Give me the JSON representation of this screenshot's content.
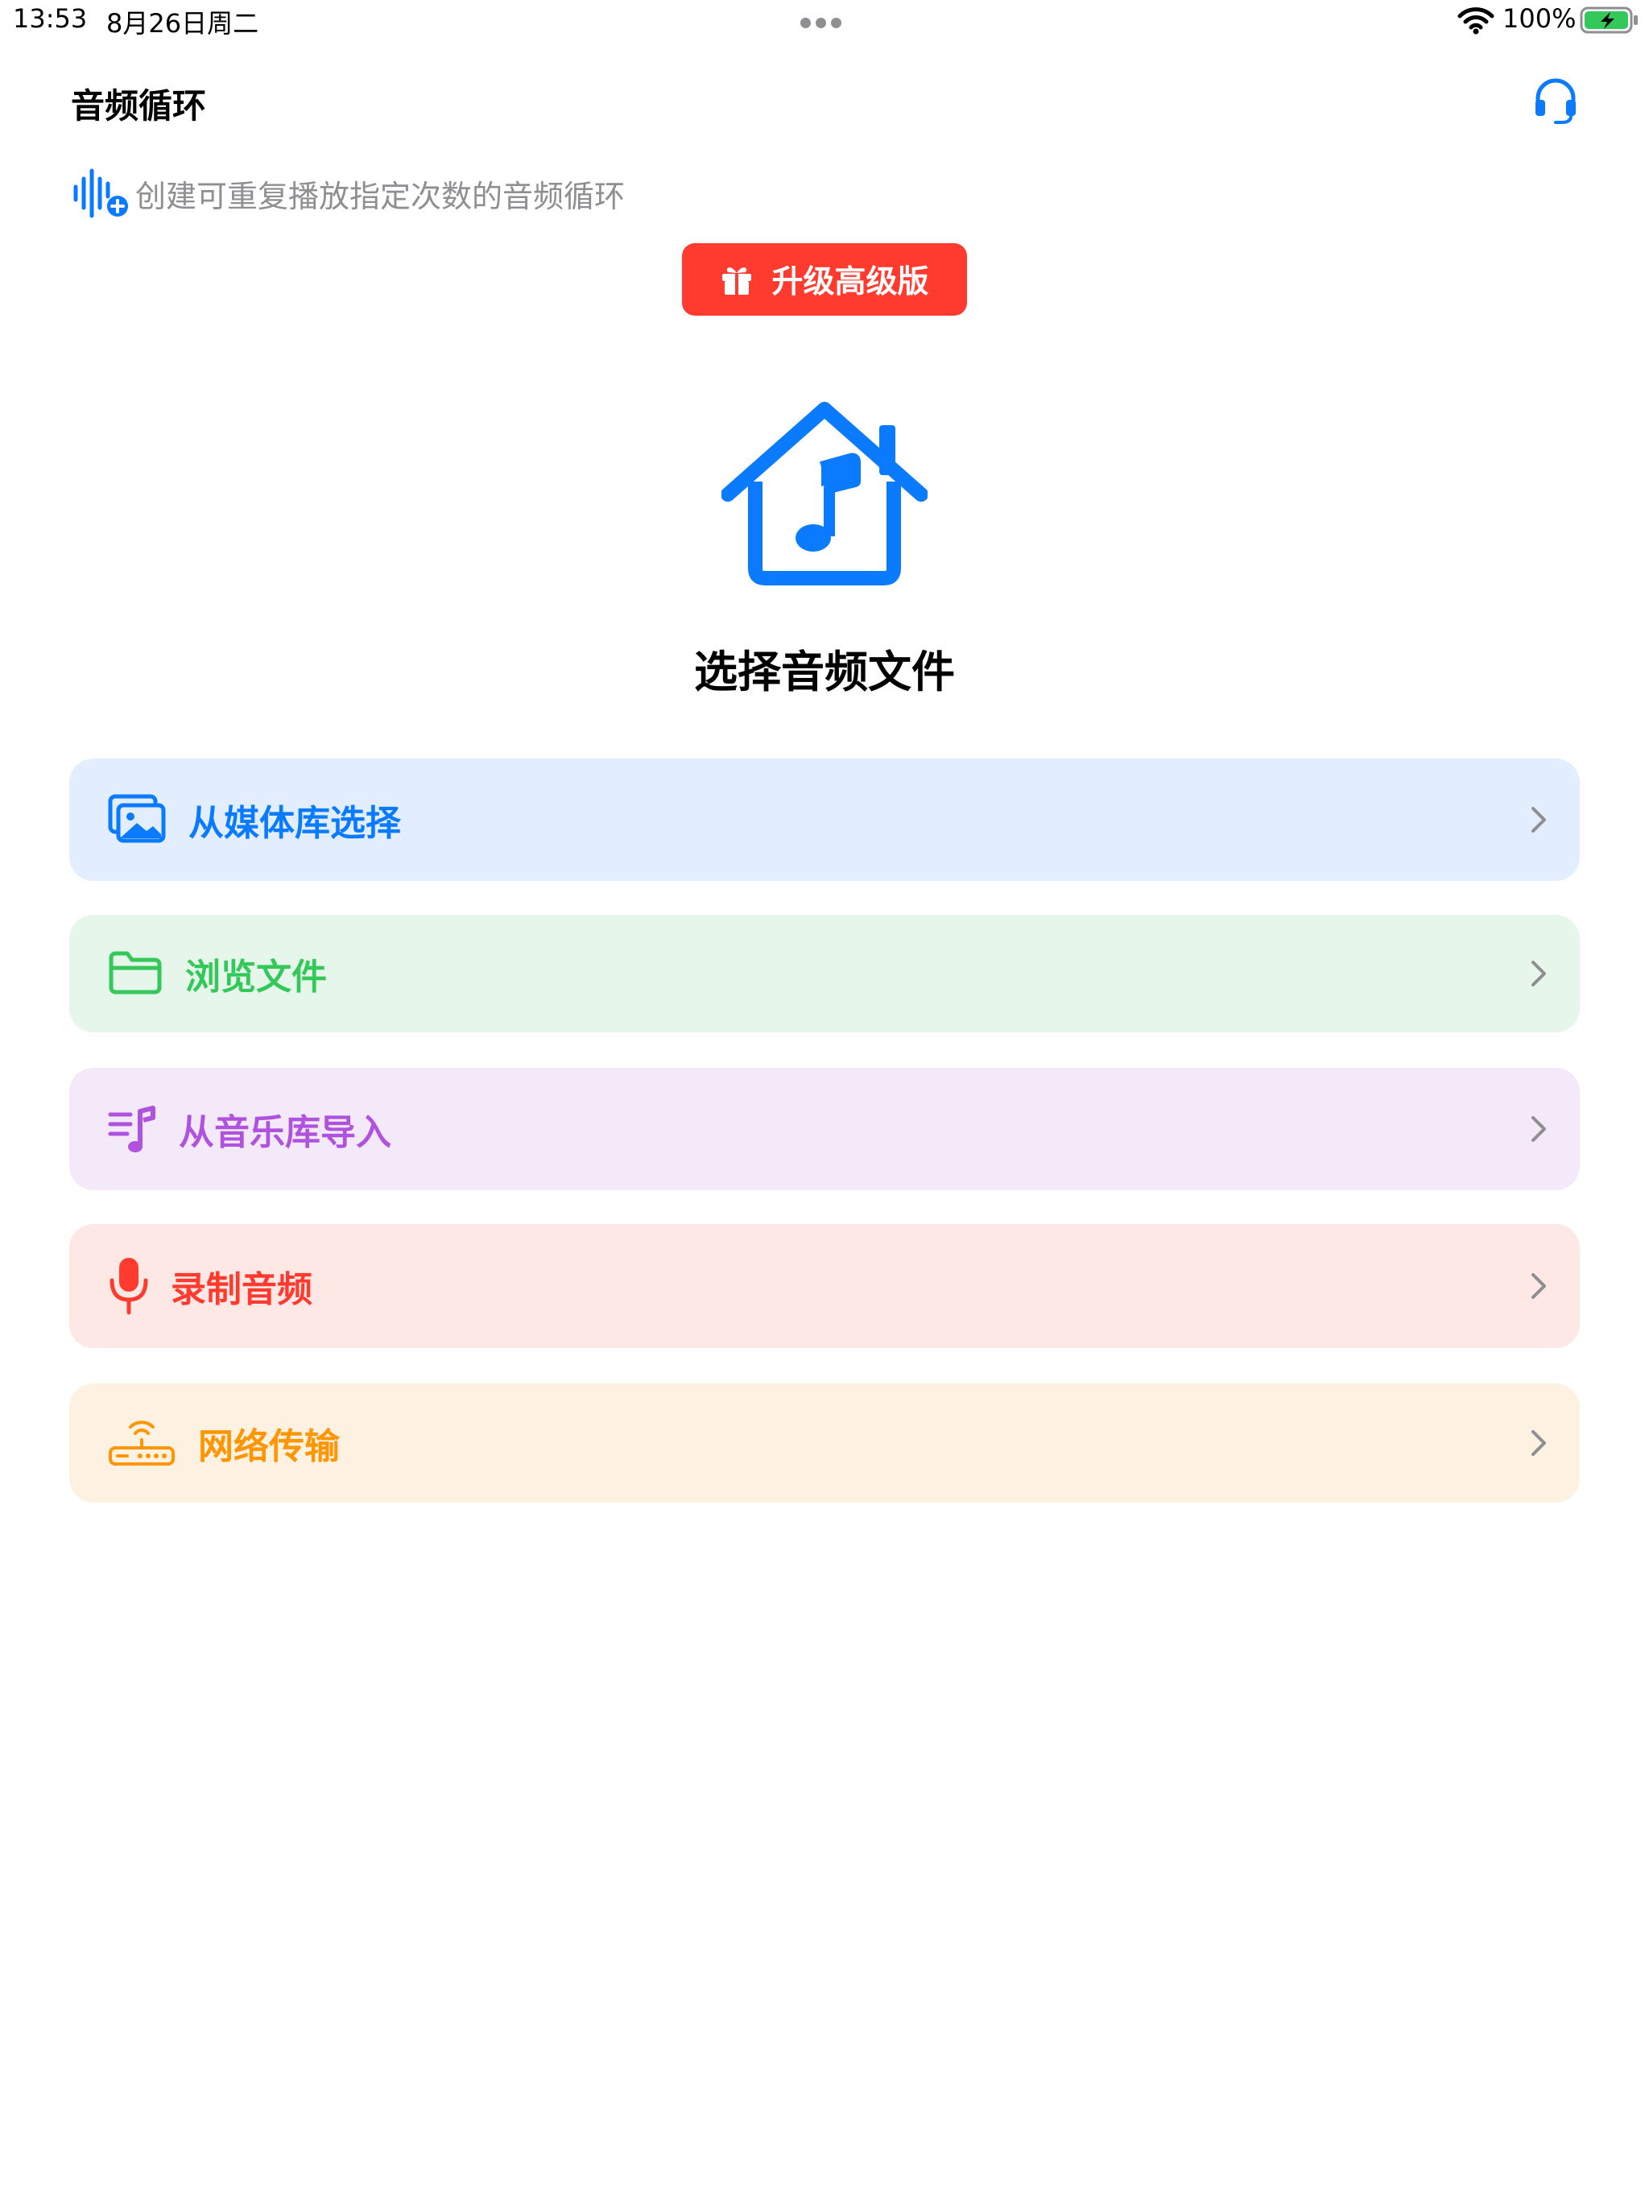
{
  "status_bar": {
    "time": "13:53",
    "date": "8月26日周二",
    "battery_percent": "100%",
    "battery_level": 1.0,
    "charging": true
  },
  "nav": {
    "title": "音频循环",
    "support_icon": "headphones-icon"
  },
  "subtitle": {
    "icon": "waveform-plus-icon",
    "text": "创建可重复播放指定次数的音频循环"
  },
  "upgrade": {
    "icon": "gift-icon",
    "label": "升级高级版",
    "color": "#ff3b30"
  },
  "hero": {
    "icon": "music-house-icon",
    "title": "选择音频文件",
    "color": "#0a7aff"
  },
  "options": [
    {
      "label": "从媒体库选择",
      "icon": "photo-library-icon",
      "color": "#0a7aff",
      "background": "#e2eefd"
    },
    {
      "label": "浏览文件",
      "icon": "folder-icon",
      "color": "#34c759",
      "background": "#e6f6ea"
    },
    {
      "label": "从音乐库导入",
      "icon": "music-list-icon",
      "color": "#af52de",
      "background": "#f4e9f8"
    },
    {
      "label": "录制音频",
      "icon": "microphone-icon",
      "color": "#ff3b30",
      "background": "#fde8e6"
    },
    {
      "label": "网络传输",
      "icon": "wifi-router-icon",
      "color": "#ff9500",
      "background": "#fdf1e2"
    }
  ]
}
